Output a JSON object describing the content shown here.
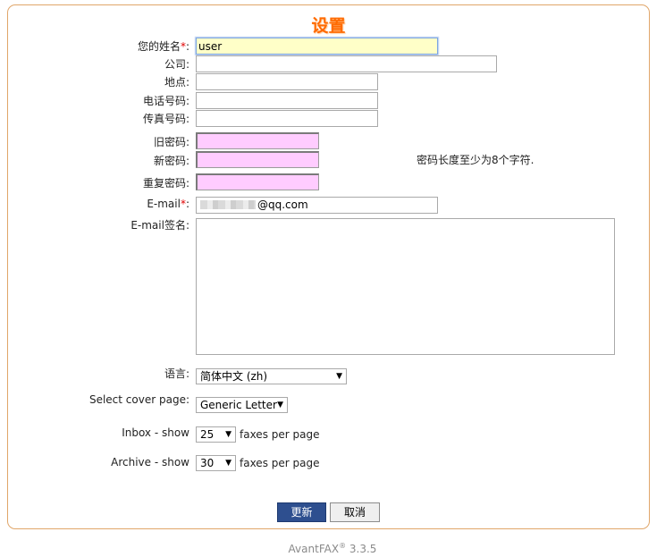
{
  "title": "设置",
  "fields": {
    "name": {
      "label": "您的姓名",
      "required": "*",
      "colon": ":",
      "value": "user"
    },
    "company": {
      "label": "公司:",
      "value": ""
    },
    "location": {
      "label": "地点:",
      "value": ""
    },
    "phone": {
      "label": "电话号码:",
      "value": ""
    },
    "fax": {
      "label": "传真号码:",
      "value": ""
    },
    "old_password": {
      "label": "旧密码:",
      "value": ""
    },
    "new_password": {
      "label": "新密码:",
      "value": ""
    },
    "repeat_password": {
      "label": "重复密码:",
      "value": ""
    },
    "email": {
      "label": "E-mail",
      "required": "*",
      "colon": ":",
      "value_suffix": "@qq.com"
    },
    "email_signature": {
      "label": "E-mail签名:",
      "value": ""
    }
  },
  "password_hint": "密码长度至少为8个字符.",
  "language": {
    "label": "语言:",
    "selected": "简体中文 (zh)"
  },
  "cover_page": {
    "label": "Select cover page:",
    "selected": "Generic Letter"
  },
  "inbox": {
    "label": "Inbox - show",
    "selected": "25",
    "suffix": "faxes per page"
  },
  "archive": {
    "label": "Archive - show",
    "selected": "30",
    "suffix": "faxes per page"
  },
  "buttons": {
    "update": "更新",
    "cancel": "取消"
  },
  "footer": {
    "product": "AvantFAX",
    "reg": "®",
    "version": "3.3.5"
  },
  "icons": {
    "dropdown": "chevron-down-icon"
  }
}
